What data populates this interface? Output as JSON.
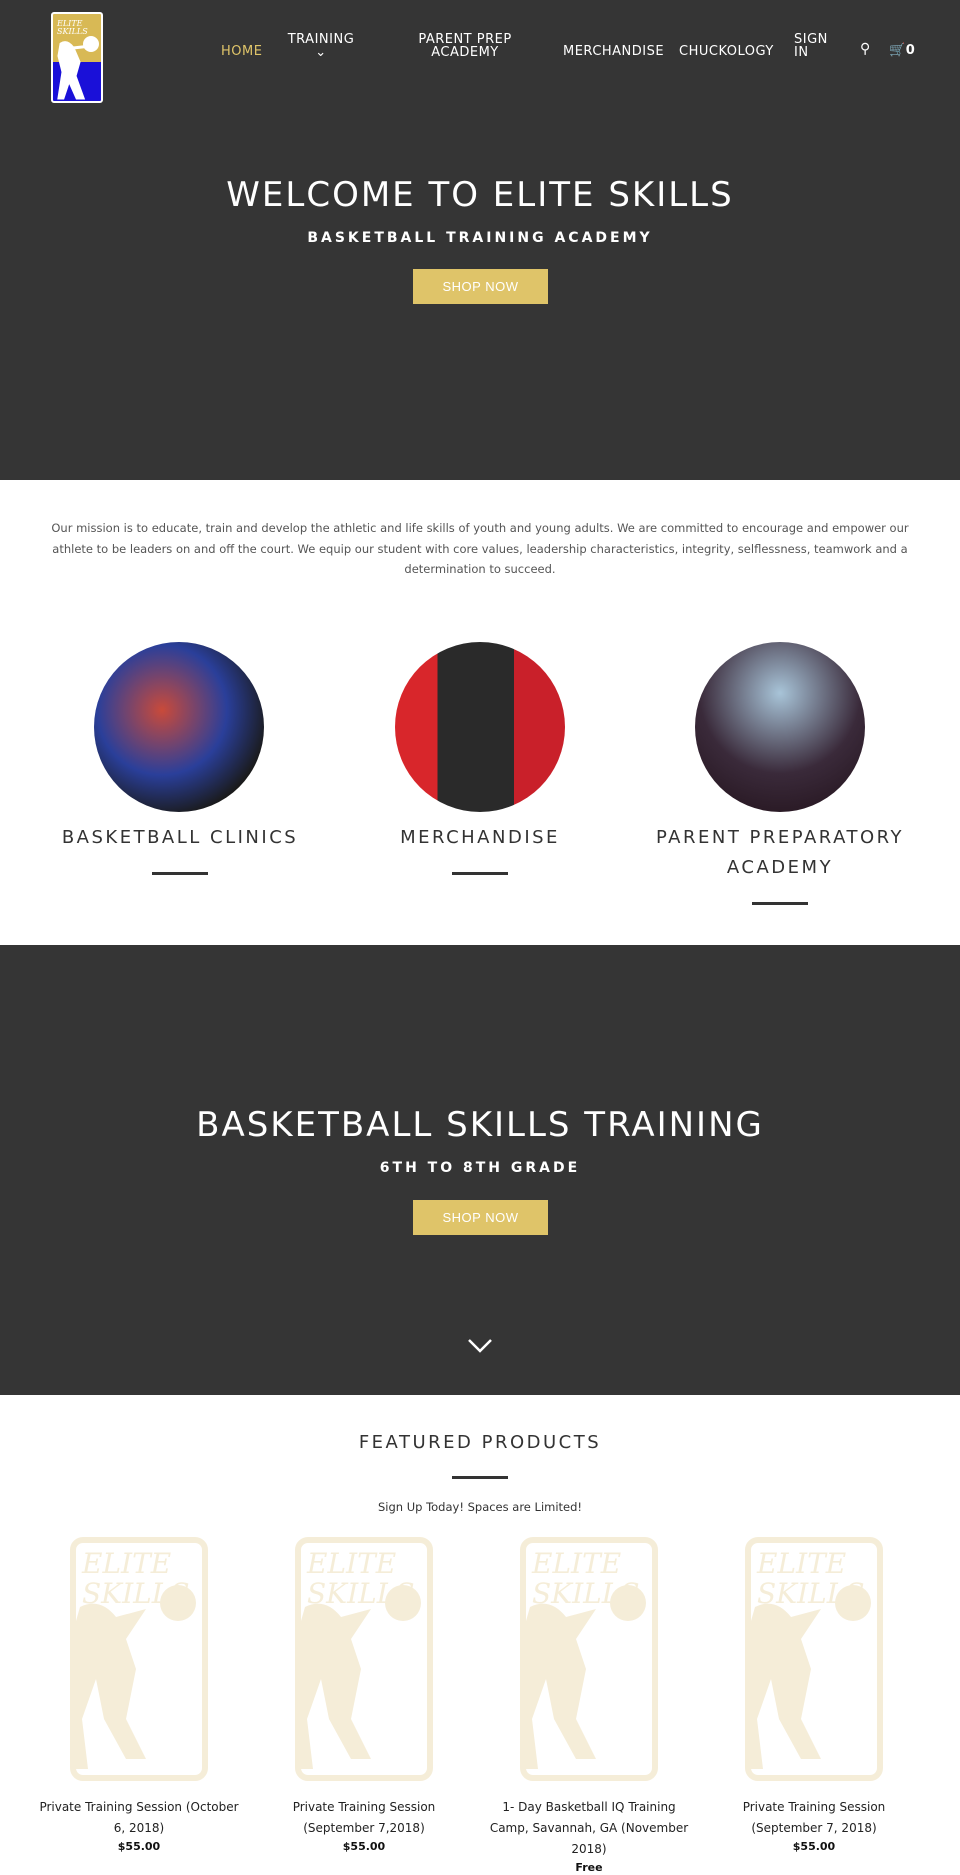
{
  "header": {
    "logo_text": "ELITE SKILLS",
    "nav": [
      {
        "label": "HOME",
        "active": true
      },
      {
        "label": "TRAINING",
        "has_dropdown": true
      },
      {
        "label": "PARENT PREP ACADEMY"
      },
      {
        "label": "MERCHANDISE"
      },
      {
        "label": "CHUCKOLOGY"
      },
      {
        "label": "SIGN IN"
      }
    ],
    "cart_count": "0",
    "icons": [
      "search-icon",
      "cart-icon",
      "chevron-down-icon"
    ]
  },
  "hero": {
    "title": "WELCOME TO ELITE SKILLS",
    "subtitle": "BASKETBALL TRAINING ACADEMY",
    "button": "SHOP NOW"
  },
  "mission": "Our mission is to educate, train and develop the athletic and life skills of youth and young adults.  We are committed to encourage and empower our athlete to be leaders on and off the court.  We equip our student with core values, leadership characteristics, integrity, selflessness, teamwork and a determination to succeed.",
  "features": [
    {
      "label": "BASKETBALL CLINICS"
    },
    {
      "label": "MERCHANDISE"
    },
    {
      "label": "PARENT PREPARATORY ACADEMY"
    }
  ],
  "banner": {
    "title": "BASKETBALL SKILLS TRAINING",
    "subtitle": "6TH TO 8TH GRADE",
    "button": "SHOP NOW"
  },
  "featured": {
    "title": "FEATURED PRODUCTS",
    "subtitle": "Sign Up Today! Spaces are Limited!",
    "products": [
      {
        "title": "Private Training Session (October 6, 2018)",
        "price": "$55.00"
      },
      {
        "title": "Private Training Session (September 7,2018)",
        "price": "$55.00"
      },
      {
        "title": "1- Day Basketball IQ Training Camp, Savannah, GA (November 2018)",
        "price": "Free"
      },
      {
        "title": "Private Training Session (September 7, 2018)",
        "price": "$55.00"
      }
    ]
  },
  "colors": {
    "dark": "#353535",
    "accent": "#dfc469",
    "logo_blue": "#1a10d8"
  }
}
